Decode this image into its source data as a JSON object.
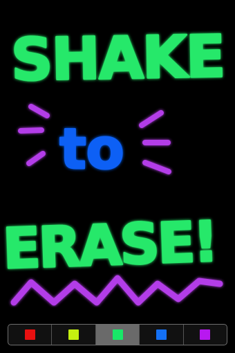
{
  "canvas": {
    "line1": "SHAKE",
    "line2": "to",
    "line3": "ERASE!",
    "colors": {
      "line1": "#27e86a",
      "line2": "#1160f5",
      "line3": "#27e86a",
      "exclamation": "#b33de8",
      "rays": "#b33de8",
      "zigzag": "#b33de8"
    }
  },
  "palette": {
    "selected_index": 2,
    "swatches": [
      {
        "name": "red",
        "color": "#e81010"
      },
      {
        "name": "yellow-green",
        "color": "#c4f010"
      },
      {
        "name": "green",
        "color": "#18e868"
      },
      {
        "name": "blue",
        "color": "#1470f4"
      },
      {
        "name": "purple",
        "color": "#b818f0"
      }
    ]
  }
}
